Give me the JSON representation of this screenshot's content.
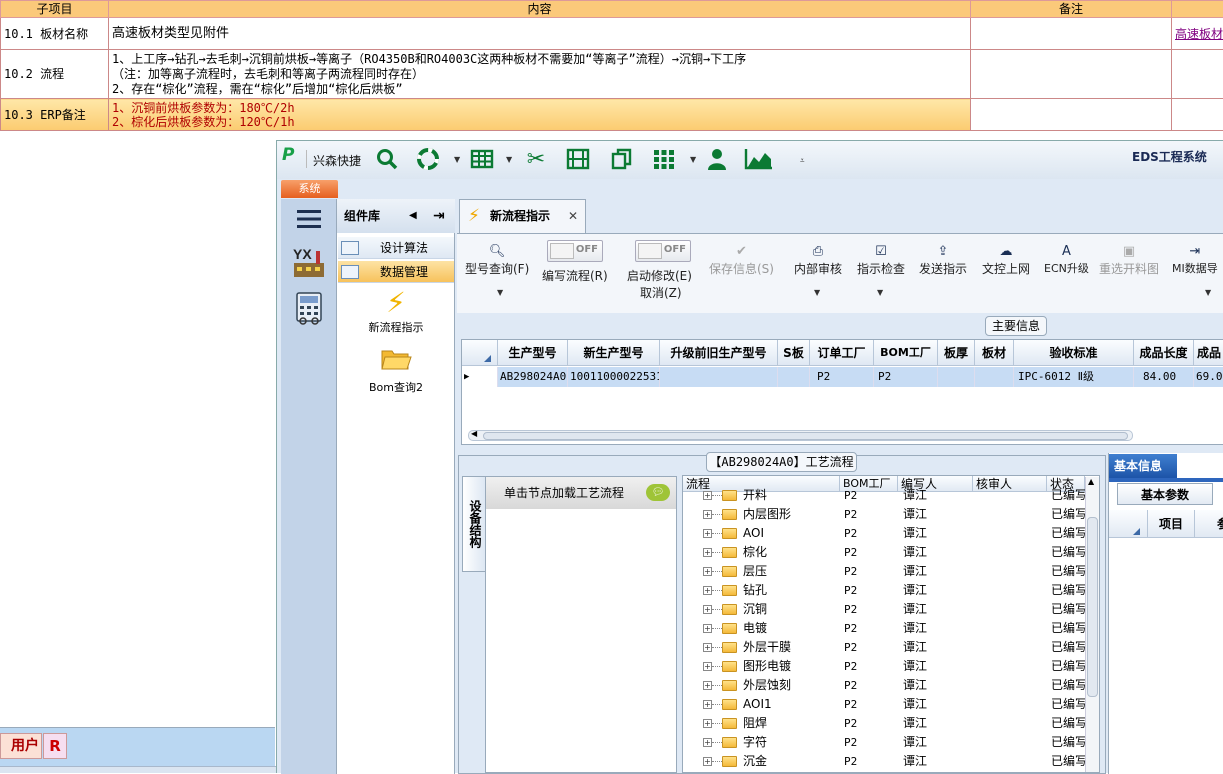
{
  "sheet": {
    "headers": [
      "子项目",
      "内容",
      "备注",
      ""
    ],
    "rows": [
      {
        "k": "10.1 板材名称",
        "content": [
          "高速板材类型见附件"
        ],
        "note": "",
        "extra": "高速板材"
      },
      {
        "k": "10.2 流程",
        "content": [
          "1、上工序→钻孔→去毛刺→沉铜前烘板→等离子（RO4350B和RO4003C这两种板材不需要加“等离子”流程）→沉铜→下工序",
          "（注：加等离子流程时，去毛刺和等离子两流程同时存在）",
          "2、存在“棕化”流程，需在“棕化”后增加“棕化后烘板”"
        ],
        "note": "",
        "extra": ""
      },
      {
        "k": "10.3 ERP备注",
        "content": [
          "1、沉铜前烘板参数为：180℃/2h",
          "2、棕化后烘板参数为：120℃/1h"
        ],
        "note": "",
        "extra": ""
      }
    ]
  },
  "taskbar": {
    "user_tab": "用户",
    "r_tab": "R"
  },
  "app": {
    "brand": "兴森快捷",
    "system_title": "EDS工程系统",
    "system_tab": "系统",
    "toolbar_icons": [
      "search-icon",
      "lifebuoy-icon",
      "table-icon",
      "scissors-icon",
      "film-icon",
      "copy-icon",
      "grid-icon",
      "user-icon",
      "area-chart-icon"
    ],
    "component_library": {
      "title": "组件库",
      "items": [
        "设计算法",
        "数据管理"
      ],
      "big_items": [
        "新流程指示",
        "Bom查询2"
      ]
    },
    "main_tab": "新流程指示",
    "ribbon": {
      "model_query": "型号查询(F)",
      "edit_flow": "编写流程(R)",
      "start_modify": "启动修改(E)",
      "cancel": "取消(Z)",
      "off": "OFF",
      "save_info": "保存信息(S)",
      "internal_review": "内部审核",
      "instruction_check": "指示检查",
      "send_instruction": "发送指示",
      "upload_doc": "文控上网",
      "ecn_upgrade": "ECN升级",
      "reselect_image": "重选开料图",
      "mi_data": "MI数据导"
    },
    "main_info": {
      "title": "主要信息",
      "columns": [
        "生产型号",
        "新生产型号",
        "升级前旧生产型号",
        "S板",
        "订单工厂",
        "BOM工厂",
        "板厚",
        "板材",
        "验收标准",
        "成品长度",
        "成品"
      ],
      "row": [
        "AB298024A0",
        "10011000022531",
        "",
        "",
        "P2",
        "P2",
        "",
        "",
        "IPC-6012 Ⅱ级",
        "84.00",
        "69.0"
      ]
    },
    "process_flow": {
      "title": "【AB298024A0】工艺流程",
      "side_tab": "设备结构",
      "node_hint": "单击节点加载工艺流程",
      "columns": [
        "流程",
        "BOM工厂",
        "编写人",
        "核审人",
        "状态"
      ],
      "rows": [
        {
          "name": "开料",
          "bom": "P2",
          "writer": "谭江",
          "status": "已编写"
        },
        {
          "name": "内层图形",
          "bom": "P2",
          "writer": "谭江",
          "status": "已编写"
        },
        {
          "name": "AOI",
          "bom": "P2",
          "writer": "谭江",
          "status": "已编写"
        },
        {
          "name": "棕化",
          "bom": "P2",
          "writer": "谭江",
          "status": "已编写"
        },
        {
          "name": "层压",
          "bom": "P2",
          "writer": "谭江",
          "status": "已编写"
        },
        {
          "name": "钻孔",
          "bom": "P2",
          "writer": "谭江",
          "status": "已编写"
        },
        {
          "name": "沉铜",
          "bom": "P2",
          "writer": "谭江",
          "status": "已编写"
        },
        {
          "name": "电镀",
          "bom": "P2",
          "writer": "谭江",
          "status": "已编写"
        },
        {
          "name": "外层干膜",
          "bom": "P2",
          "writer": "谭江",
          "status": "已编写"
        },
        {
          "name": "图形电镀",
          "bom": "P2",
          "writer": "谭江",
          "status": "已编写"
        },
        {
          "name": "外层蚀刻",
          "bom": "P2",
          "writer": "谭江",
          "status": "已编写"
        },
        {
          "name": "AOI1",
          "bom": "P2",
          "writer": "谭江",
          "status": "已编写"
        },
        {
          "name": "阻焊",
          "bom": "P2",
          "writer": "谭江",
          "status": "已编写"
        },
        {
          "name": "字符",
          "bom": "P2",
          "writer": "谭江",
          "status": "已编写"
        },
        {
          "name": "沉金",
          "bom": "P2",
          "writer": "谭江",
          "status": "已编写"
        }
      ]
    },
    "basic_info": {
      "tab": "基本信息",
      "sub_tab": "基本参数",
      "col1": "项目",
      "col2": "参"
    }
  }
}
